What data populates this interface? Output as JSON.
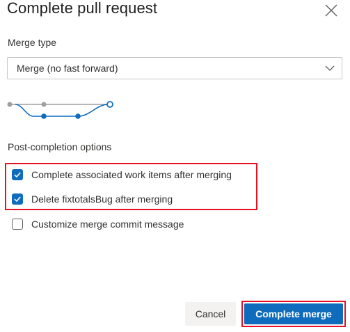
{
  "dialog": {
    "title": "Complete pull request",
    "merge_type_label": "Merge type",
    "merge_type_value": "Merge (no fast forward)",
    "post_completion_label": "Post-completion options",
    "options": [
      {
        "label": "Complete associated work items after merging",
        "checked": true
      },
      {
        "label": "Delete fixtotalsBug after merging",
        "checked": true
      },
      {
        "label": "Customize merge commit message",
        "checked": false
      }
    ],
    "cancel_label": "Cancel",
    "complete_label": "Complete merge"
  },
  "colors": {
    "accent": "#0f6cbd",
    "highlight": "#e81123",
    "graph_gray": "#a19f9d"
  },
  "icons": {
    "close": "close-icon",
    "dropdown": "chevron-down-icon",
    "checkbox": "checkmark-icon",
    "graph": "merge-graph-icon"
  }
}
